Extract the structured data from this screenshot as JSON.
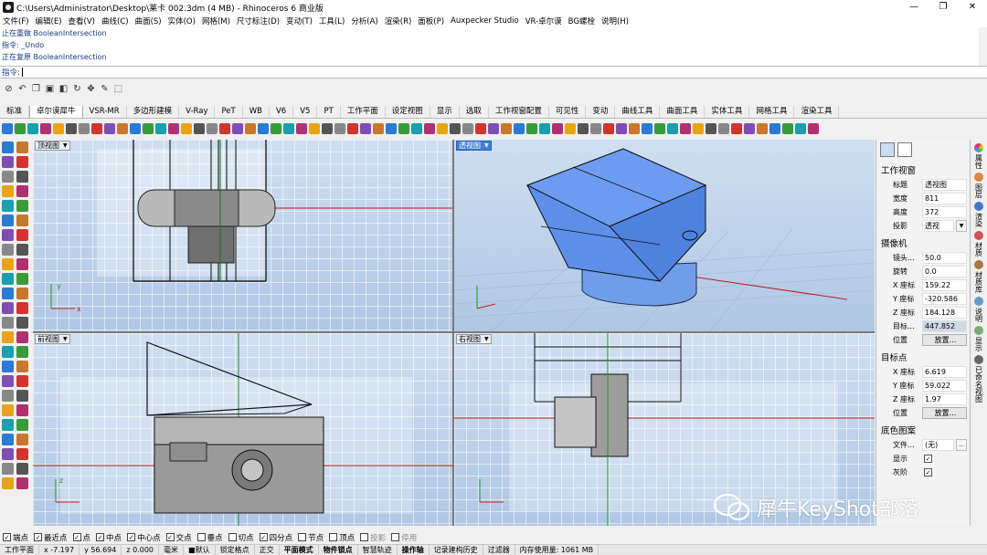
{
  "window": {
    "title": "C:\\Users\\Administrator\\Desktop\\莱卡 002.3dm (4 MB) - Rhinoceros 6 商业版",
    "controls": [
      "—",
      "❐",
      "✕"
    ]
  },
  "menu": [
    "文件(F)",
    "编辑(E)",
    "查看(V)",
    "曲线(C)",
    "曲面(S)",
    "实体(O)",
    "网格(M)",
    "尺寸标注(D)",
    "变动(T)",
    "工具(L)",
    "分析(A)",
    "渲染(R)",
    "面板(P)",
    "Auxpecker Studio",
    "VR-卓尔谟",
    "BG螺栓",
    "说明(H)"
  ],
  "command_history": [
    "止在重做 BooleanIntersection",
    "指令: _Undo",
    "正在复原 BooleanIntersection"
  ],
  "command_prompt": "指令:",
  "tabs": [
    "标准",
    "卓尔谟犀牛",
    "VSR-MR",
    "多边形建模",
    "V-Ray",
    "PeT",
    "WB",
    "V6",
    "V5",
    "PT",
    "工作平面",
    "设定视图",
    "显示",
    "选取",
    "工作视窗配置",
    "可见性",
    "变动",
    "曲线工具",
    "曲面工具",
    "实体工具",
    "网格工具",
    "渲染工具"
  ],
  "active_tab_index": 1,
  "viewports": {
    "top": {
      "label": "顶视图"
    },
    "perspective": {
      "label": "透视图"
    },
    "front": {
      "label": "前视图"
    },
    "right": {
      "label": "右视图"
    }
  },
  "axis_labels": {
    "x": "x",
    "y": "y",
    "z": "z"
  },
  "panel": {
    "section_viewport": "工作视窗",
    "title_label": "标题",
    "title_value": "透视图",
    "width_label": "宽度",
    "width_value": "811",
    "height_label": "高度",
    "height_value": "372",
    "projection_label": "投影",
    "projection_value": "透视",
    "section_camera": "摄像机",
    "lens_label": "镜头...",
    "lens_value": "50.0",
    "rotate_label": "旋转",
    "rotate_value": "0.0",
    "cx_label": "X 座标",
    "cx_value": "159.22",
    "cy_label": "Y 座标",
    "cy_value": "-320.586",
    "cz_label": "Z 座标",
    "cz_value": "184.128",
    "target_dist_label": "目标...",
    "target_dist_value": "447.852",
    "pos_label": "位置",
    "pos_button": "放置...",
    "section_target": "目标点",
    "tx_label": "X 座标",
    "tx_value": "6.619",
    "ty_label": "Y 座标",
    "ty_value": "59.022",
    "tz_label": "Z 座标",
    "tz_value": "1.97",
    "tpos_label": "位置",
    "tpos_button": "放置...",
    "section_wallpaper": "底色图案",
    "file_label": "文件...",
    "file_value": "(无)",
    "file_button": "...",
    "show_label": "显示",
    "gray_label": "灰阶"
  },
  "side_tabs": [
    "属性",
    "图层",
    "渲染",
    "材质",
    "材质库",
    "说明",
    "显示",
    "已命名视图"
  ],
  "osnaps": [
    {
      "label": "端点",
      "checked": true
    },
    {
      "label": "最近点",
      "checked": true
    },
    {
      "label": "点",
      "checked": true
    },
    {
      "label": "中点",
      "checked": true
    },
    {
      "label": "中心点",
      "checked": true
    },
    {
      "label": "交点",
      "checked": true
    },
    {
      "label": "垂点",
      "checked": false
    },
    {
      "label": "切点",
      "checked": false
    },
    {
      "label": "四分点",
      "checked": true
    },
    {
      "label": "节点",
      "checked": false
    },
    {
      "label": "顶点",
      "checked": false
    },
    {
      "label": "投影",
      "checked": false,
      "disabled": true
    },
    {
      "label": "停用",
      "checked": false,
      "disabled": true
    }
  ],
  "status": {
    "cplane": "工作平面",
    "x": "x -7.197",
    "y": "y 56.694",
    "z": "z 0.000",
    "units": "毫米",
    "layer": "■默认",
    "grid_snap": "锁定格点",
    "ortho": "正交",
    "planar": "平面模式",
    "osnap": "物件锁点",
    "smarttrack": "智慧轨迹",
    "gumball": "操作轴",
    "history": "记录建构历史",
    "filter": "过滤器",
    "memory": "内存使用量: 1061 MB"
  },
  "watermark": "犀牛KeyShot部落",
  "colors": {
    "viewport_top": "#d0dff1",
    "accent": "#3f7fd6",
    "model_blue": "#5a8fe8"
  }
}
